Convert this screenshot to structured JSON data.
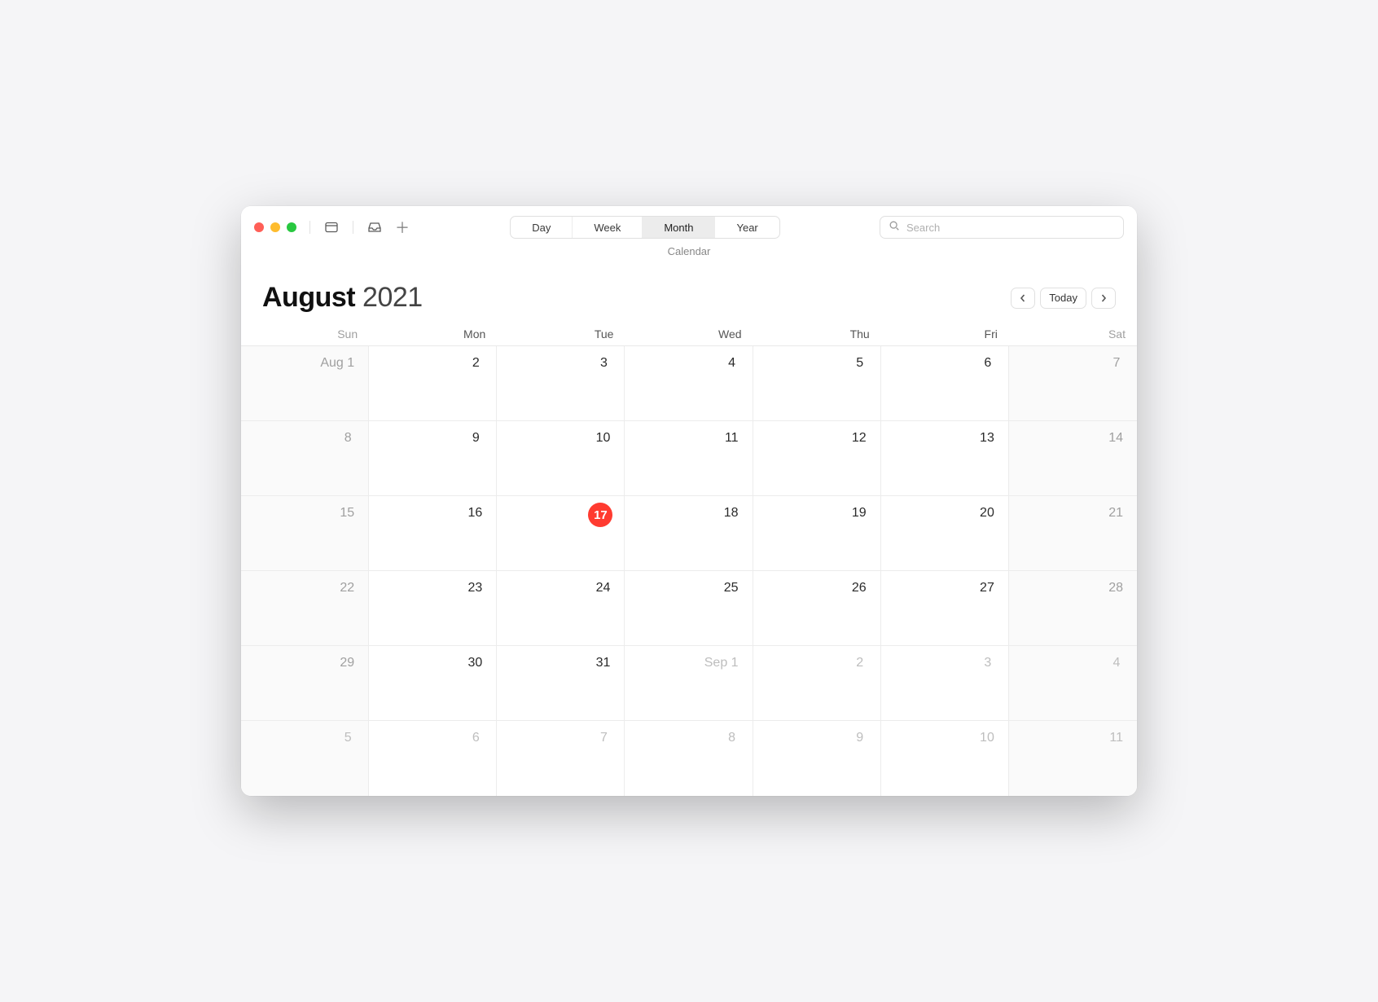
{
  "toolbar": {
    "view_tabs": [
      "Day",
      "Week",
      "Month",
      "Year"
    ],
    "active_view": "Month",
    "search_placeholder": "Search"
  },
  "window": {
    "subtitle": "Calendar"
  },
  "header": {
    "month": "August",
    "year": "2021",
    "today_label": "Today"
  },
  "weekdays": [
    "Sun",
    "Mon",
    "Tue",
    "Wed",
    "Thu",
    "Fri",
    "Sat"
  ],
  "days": [
    {
      "label": "Aug 1",
      "weekend": true,
      "outside": false,
      "today": false
    },
    {
      "label": "2",
      "weekend": false,
      "outside": false,
      "today": false
    },
    {
      "label": "3",
      "weekend": false,
      "outside": false,
      "today": false
    },
    {
      "label": "4",
      "weekend": false,
      "outside": false,
      "today": false
    },
    {
      "label": "5",
      "weekend": false,
      "outside": false,
      "today": false
    },
    {
      "label": "6",
      "weekend": false,
      "outside": false,
      "today": false
    },
    {
      "label": "7",
      "weekend": true,
      "outside": false,
      "today": false
    },
    {
      "label": "8",
      "weekend": true,
      "outside": false,
      "today": false
    },
    {
      "label": "9",
      "weekend": false,
      "outside": false,
      "today": false
    },
    {
      "label": "10",
      "weekend": false,
      "outside": false,
      "today": false
    },
    {
      "label": "11",
      "weekend": false,
      "outside": false,
      "today": false
    },
    {
      "label": "12",
      "weekend": false,
      "outside": false,
      "today": false
    },
    {
      "label": "13",
      "weekend": false,
      "outside": false,
      "today": false
    },
    {
      "label": "14",
      "weekend": true,
      "outside": false,
      "today": false
    },
    {
      "label": "15",
      "weekend": true,
      "outside": false,
      "today": false
    },
    {
      "label": "16",
      "weekend": false,
      "outside": false,
      "today": false
    },
    {
      "label": "17",
      "weekend": false,
      "outside": false,
      "today": true
    },
    {
      "label": "18",
      "weekend": false,
      "outside": false,
      "today": false
    },
    {
      "label": "19",
      "weekend": false,
      "outside": false,
      "today": false
    },
    {
      "label": "20",
      "weekend": false,
      "outside": false,
      "today": false
    },
    {
      "label": "21",
      "weekend": true,
      "outside": false,
      "today": false
    },
    {
      "label": "22",
      "weekend": true,
      "outside": false,
      "today": false
    },
    {
      "label": "23",
      "weekend": false,
      "outside": false,
      "today": false
    },
    {
      "label": "24",
      "weekend": false,
      "outside": false,
      "today": false
    },
    {
      "label": "25",
      "weekend": false,
      "outside": false,
      "today": false
    },
    {
      "label": "26",
      "weekend": false,
      "outside": false,
      "today": false
    },
    {
      "label": "27",
      "weekend": false,
      "outside": false,
      "today": false
    },
    {
      "label": "28",
      "weekend": true,
      "outside": false,
      "today": false
    },
    {
      "label": "29",
      "weekend": true,
      "outside": false,
      "today": false
    },
    {
      "label": "30",
      "weekend": false,
      "outside": false,
      "today": false
    },
    {
      "label": "31",
      "weekend": false,
      "outside": false,
      "today": false
    },
    {
      "label": "Sep 1",
      "weekend": false,
      "outside": true,
      "today": false
    },
    {
      "label": "2",
      "weekend": false,
      "outside": true,
      "today": false
    },
    {
      "label": "3",
      "weekend": false,
      "outside": true,
      "today": false
    },
    {
      "label": "4",
      "weekend": true,
      "outside": true,
      "today": false
    },
    {
      "label": "5",
      "weekend": true,
      "outside": true,
      "today": false
    },
    {
      "label": "6",
      "weekend": false,
      "outside": true,
      "today": false
    },
    {
      "label": "7",
      "weekend": false,
      "outside": true,
      "today": false
    },
    {
      "label": "8",
      "weekend": false,
      "outside": true,
      "today": false
    },
    {
      "label": "9",
      "weekend": false,
      "outside": true,
      "today": false
    },
    {
      "label": "10",
      "weekend": false,
      "outside": true,
      "today": false
    },
    {
      "label": "11",
      "weekend": true,
      "outside": true,
      "today": false
    }
  ]
}
